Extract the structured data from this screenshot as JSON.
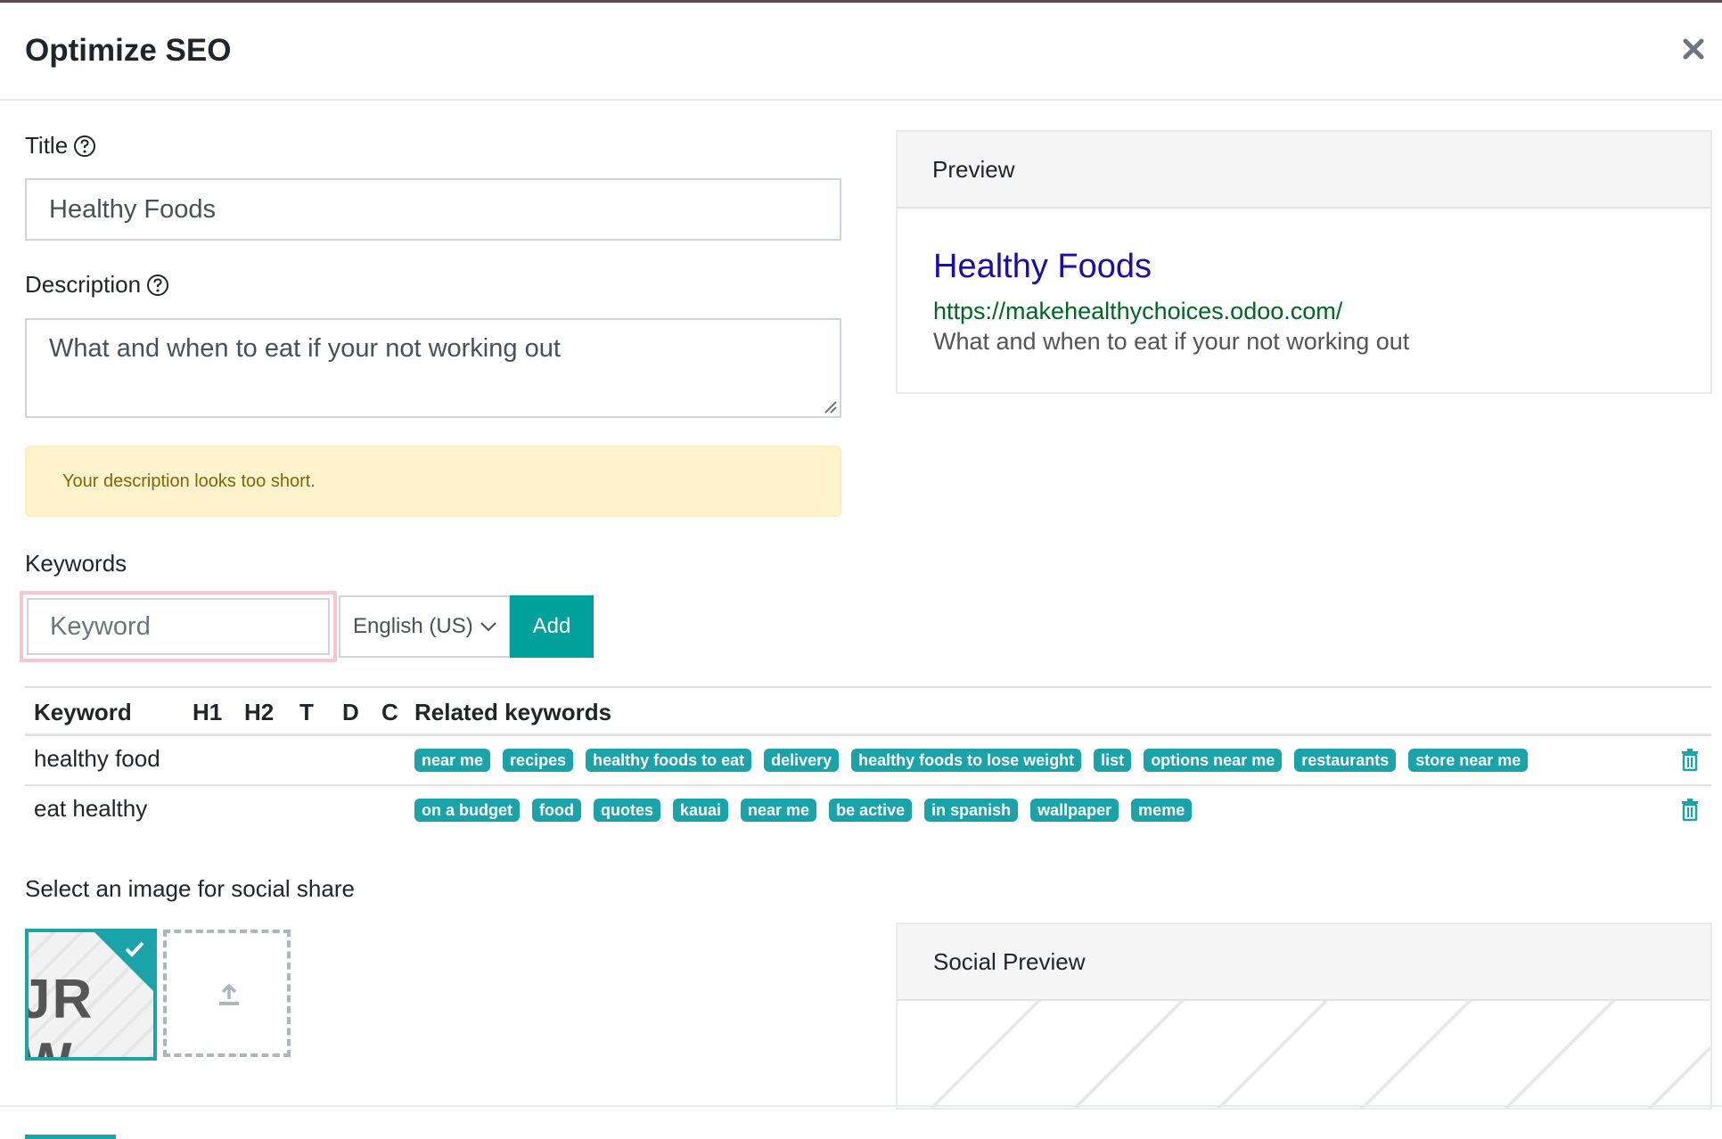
{
  "modal": {
    "title": "Optimize SEO"
  },
  "form": {
    "title_label": "Title",
    "title_value": "Healthy Foods",
    "description_label": "Description",
    "description_value": "What and when to eat if your not working out",
    "warning": "Your description looks too short.",
    "keywords_label": "Keywords",
    "keyword_placeholder": "Keyword",
    "language": "English (US)",
    "add_label": "Add"
  },
  "keywords_table": {
    "headers": [
      "Keyword",
      "H1",
      "H2",
      "T",
      "D",
      "C",
      "Related keywords"
    ],
    "rows": [
      {
        "keyword": "healthy food",
        "related": [
          "near me",
          "recipes",
          "healthy foods to eat",
          "delivery",
          "healthy foods to lose weight",
          "list",
          "options near me",
          "restaurants",
          "store near me"
        ]
      },
      {
        "keyword": "eat healthy",
        "related": [
          "on a budget",
          "food",
          "quotes",
          "kauai",
          "near me",
          "be active",
          "in spanish",
          "wallpaper",
          "meme"
        ]
      }
    ]
  },
  "preview": {
    "heading": "Preview",
    "title": "Healthy Foods",
    "url": "https://makehealthychoices.odoo.com/",
    "description": "What and when to eat if your not working out"
  },
  "social": {
    "label": "Select an image for social share",
    "thumb_text": "JR W",
    "preview_heading": "Social Preview"
  },
  "colors": {
    "accent": "#1aa3a8",
    "link_blue": "#1a0dab",
    "url_green": "#006621",
    "warning_bg": "#fff3cd",
    "warning_text": "#856404"
  }
}
